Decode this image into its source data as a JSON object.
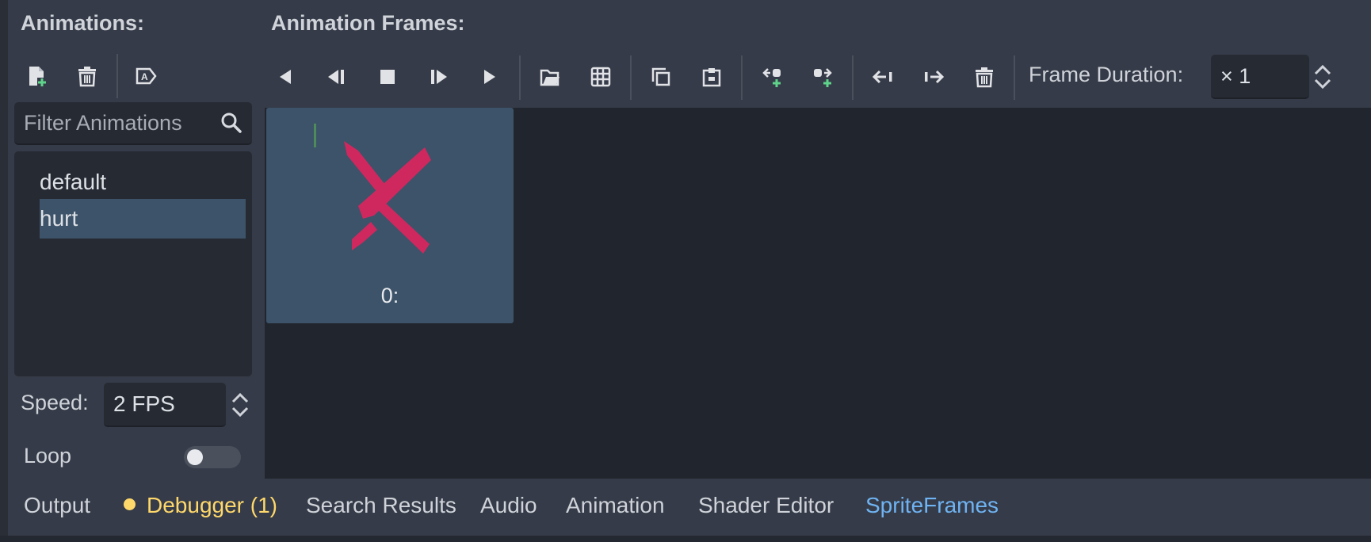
{
  "animations_panel": {
    "title": "Animations:",
    "toolbar": {
      "new_icon": "new-animation-icon",
      "delete_icon": "delete-animation-icon",
      "autoplay_icon": "autoplay-on-load-icon"
    },
    "filter": {
      "placeholder": "Filter Animations",
      "value": "",
      "icon": "search-icon"
    },
    "items": [
      {
        "label": "default",
        "selected": false
      },
      {
        "label": "hurt",
        "selected": true
      }
    ],
    "speed": {
      "label": "Speed:",
      "value": "2 FPS"
    },
    "loop": {
      "label": "Loop",
      "enabled": false
    }
  },
  "frames_panel": {
    "title": "Animation Frames:",
    "toolbar": [
      "play-backwards-from-end-icon",
      "play-backwards-icon",
      "stop-icon",
      "play-icon",
      "play-from-start-icon",
      "load-from-file-icon",
      "add-from-spritesheet-icon",
      "copy-frame-icon",
      "paste-frame-icon",
      "insert-before-icon",
      "insert-after-icon",
      "move-left-icon",
      "move-right-icon",
      "delete-frame-icon"
    ],
    "frame_duration": {
      "label": "Frame Duration:",
      "value": "× 1"
    },
    "frames": [
      {
        "label": "0:"
      }
    ]
  },
  "bottom_tabs": [
    {
      "label": "Output",
      "state": "normal"
    },
    {
      "label": "Debugger (1)",
      "state": "warning"
    },
    {
      "label": "Search Results",
      "state": "normal"
    },
    {
      "label": "Audio",
      "state": "normal"
    },
    {
      "label": "Animation",
      "state": "normal"
    },
    {
      "label": "Shader Editor",
      "state": "normal"
    },
    {
      "label": "SpriteFrames",
      "state": "active"
    }
  ],
  "colors": {
    "panel_bg": "#353b48",
    "field_bg": "#262a33",
    "selection": "#3c5369",
    "accent": "#6fb3f2",
    "warning": "#ffd86b",
    "add_green": "#5fd38a",
    "sprite_red": "#e0245e"
  }
}
